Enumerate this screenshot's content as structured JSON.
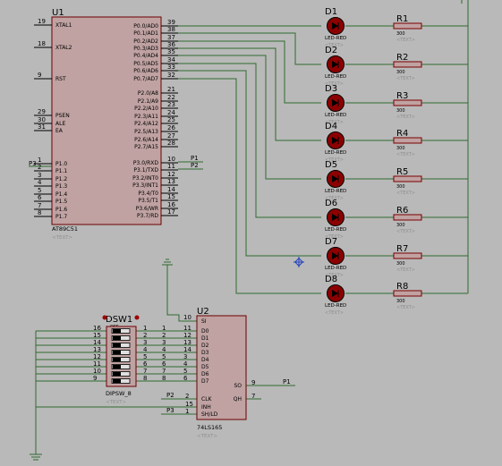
{
  "colors": {
    "background": "#b9b9b9",
    "wire": "#2f6a2f",
    "chip_body": "#c0a2a2",
    "chip_border": "#6b0000",
    "led_fill": "#8c0000",
    "resistor_border": "#7a0000",
    "hint_text": "#8f8f8f"
  },
  "u1": {
    "ref": "U1",
    "part": "AT89C51",
    "hint": "<TEXT>",
    "left_pins": [
      {
        "num": "19",
        "label": "XTAL1"
      },
      {
        "num": "18",
        "label": "XTAL2"
      },
      {
        "num": "9",
        "label": "RST"
      },
      {
        "num": "29",
        "label": "PSEN"
      },
      {
        "num": "30",
        "label": "ALE"
      },
      {
        "num": "31",
        "label": "EA"
      },
      {
        "num": "1",
        "label": "P1.0"
      },
      {
        "num": "2",
        "label": "P1.1"
      },
      {
        "num": "3",
        "label": "P1.2"
      },
      {
        "num": "4",
        "label": "P1.3"
      },
      {
        "num": "5",
        "label": "P1.4"
      },
      {
        "num": "6",
        "label": "P1.5"
      },
      {
        "num": "7",
        "label": "P1.6"
      },
      {
        "num": "8",
        "label": "P1.7"
      }
    ],
    "right_pins": [
      {
        "num": "39",
        "label": "P0.0/AD0"
      },
      {
        "num": "38",
        "label": "P0.1/AD1"
      },
      {
        "num": "37",
        "label": "P0.2/AD2"
      },
      {
        "num": "36",
        "label": "P0.3/AD3"
      },
      {
        "num": "35",
        "label": "P0.4/AD4"
      },
      {
        "num": "34",
        "label": "P0.5/AD5"
      },
      {
        "num": "33",
        "label": "P0.6/AD6"
      },
      {
        "num": "32",
        "label": "P0.7/AD7"
      },
      {
        "num": "21",
        "label": "P2.0/A8"
      },
      {
        "num": "22",
        "label": "P2.1/A9"
      },
      {
        "num": "23",
        "label": "P2.2/A10"
      },
      {
        "num": "24",
        "label": "P2.3/A11"
      },
      {
        "num": "25",
        "label": "P2.4/A12"
      },
      {
        "num": "26",
        "label": "P2.5/A13"
      },
      {
        "num": "27",
        "label": "P2.6/A14"
      },
      {
        "num": "28",
        "label": "P2.7/A15"
      },
      {
        "num": "10",
        "label": "P3.0/RXD"
      },
      {
        "num": "11",
        "label": "P3.1/TXD"
      },
      {
        "num": "12",
        "label": "P3.2/INT0"
      },
      {
        "num": "13",
        "label": "P3.3/INT1"
      },
      {
        "num": "14",
        "label": "P3.4/T0"
      },
      {
        "num": "15",
        "label": "P3.5/T1"
      },
      {
        "num": "16",
        "label": "P3.6/WR"
      },
      {
        "num": "17",
        "label": "P3.7/RD"
      }
    ],
    "net_labels": {
      "p3": "P3",
      "p1": "P1",
      "p2": "P2"
    }
  },
  "leds": [
    {
      "ref": "D1",
      "part": "LED-RED",
      "hint": "<TEXT>"
    },
    {
      "ref": "D2",
      "part": "LED-RED",
      "hint": "<TEXT>"
    },
    {
      "ref": "D3",
      "part": "LED-RED",
      "hint": "<TEXT>"
    },
    {
      "ref": "D4",
      "part": "LED-RED",
      "hint": "<TEXT>"
    },
    {
      "ref": "D5",
      "part": "LED-RED",
      "hint": "<TEXT>"
    },
    {
      "ref": "D6",
      "part": "LED-RED",
      "hint": "<TEXT>"
    },
    {
      "ref": "D7",
      "part": "LED-RED",
      "hint": "<TEXT>"
    },
    {
      "ref": "D8",
      "part": "LED-RED",
      "hint": "<TEXT>"
    }
  ],
  "resistors": [
    {
      "ref": "R1",
      "value": "300",
      "hint": "<TEXT>"
    },
    {
      "ref": "R2",
      "value": "300",
      "hint": "<TEXT>"
    },
    {
      "ref": "R3",
      "value": "300",
      "hint": "<TEXT>"
    },
    {
      "ref": "R4",
      "value": "300",
      "hint": "<TEXT>"
    },
    {
      "ref": "R5",
      "value": "300",
      "hint": "<TEXT>"
    },
    {
      "ref": "R6",
      "value": "300",
      "hint": "<TEXT>"
    },
    {
      "ref": "R7",
      "value": "300",
      "hint": "<TEXT>"
    },
    {
      "ref": "R8",
      "value": "300",
      "hint": "<TEXT>"
    }
  ],
  "dsw": {
    "ref": "DSW1",
    "part": "DIPSW_8",
    "hint": "<TEXT>",
    "switch_state": "OFF",
    "left_pins": [
      "16",
      "15",
      "14",
      "13",
      "12",
      "11",
      "10",
      "9"
    ],
    "right_pins": [
      "1",
      "2",
      "3",
      "4",
      "5",
      "6",
      "7",
      "8"
    ]
  },
  "u2": {
    "ref": "U2",
    "part": "74LS165",
    "hint": "<TEXT>",
    "top_pin": {
      "num": "10",
      "label": "SI"
    },
    "data_pins": [
      {
        "num": "11",
        "label": "D0"
      },
      {
        "num": "12",
        "label": "D1"
      },
      {
        "num": "13",
        "label": "D2"
      },
      {
        "num": "14",
        "label": "D3"
      },
      {
        "num": "3",
        "label": "D4"
      },
      {
        "num": "4",
        "label": "D5"
      },
      {
        "num": "5",
        "label": "D6"
      },
      {
        "num": "6",
        "label": "D7"
      }
    ],
    "ctrl_pins": [
      {
        "num": "2",
        "label": "CLK"
      },
      {
        "num": "15",
        "label": "INH"
      },
      {
        "num": "1",
        "label": "SH/LD"
      }
    ],
    "out_pins": [
      {
        "num": "9",
        "label": "SO"
      },
      {
        "num": "7",
        "label": "QH"
      }
    ],
    "dsw_pin_numbers": [
      "1",
      "2",
      "3",
      "4",
      "5",
      "6",
      "7",
      "8"
    ],
    "net_labels": {
      "clk": "P2",
      "shld": "P3",
      "so": "P1"
    }
  }
}
